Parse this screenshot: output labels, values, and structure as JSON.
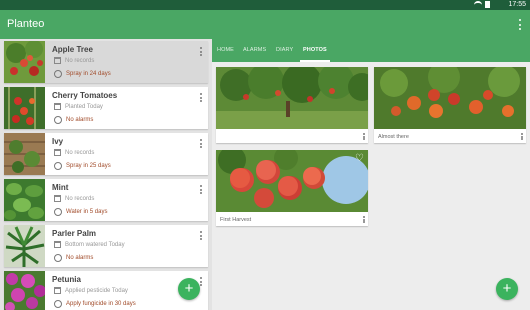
{
  "status_bar": {
    "time": "17:55"
  },
  "app": {
    "title": "Planteo"
  },
  "plants": [
    {
      "name": "Apple Tree",
      "status": "No records",
      "alarm": "Spray in 24 days"
    },
    {
      "name": "Cherry Tomatoes",
      "status": "Planted Today",
      "alarm": "No alarms"
    },
    {
      "name": "Ivy",
      "status": "No records",
      "alarm": "Spray in 25 days"
    },
    {
      "name": "Mint",
      "status": "No records",
      "alarm": "Water in 5 days"
    },
    {
      "name": "Parler Palm",
      "status": "Bottom watered Today",
      "alarm": "No alarms"
    },
    {
      "name": "Petunia",
      "status": "Applied pesticide Today",
      "alarm": "Apply fungicide in 30 days"
    }
  ],
  "tabs": [
    "HOME",
    "ALARMS",
    "DIARY",
    "PHOTOS"
  ],
  "active_tab": "PHOTOS",
  "photos": [
    {
      "caption": ""
    },
    {
      "caption": "Almost there"
    },
    {
      "caption": "First Harvest"
    }
  ],
  "icons": {
    "add": "+",
    "favorite": "♡"
  },
  "colors": {
    "primary": "#4aa764",
    "statusbar": "#1f5d3a",
    "fab": "#3bb35e",
    "alarm_text": "#a14b2a"
  }
}
